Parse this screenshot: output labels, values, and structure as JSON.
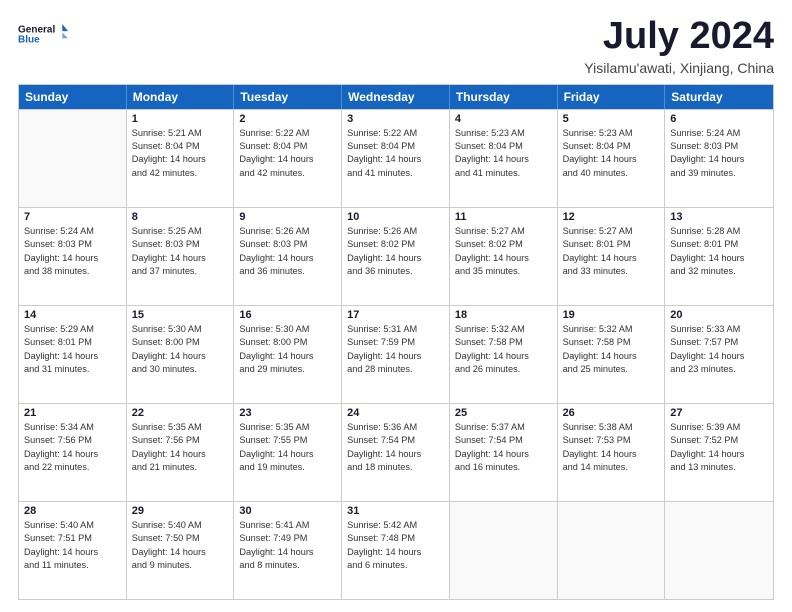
{
  "logo": {
    "line1": "General",
    "line2": "Blue"
  },
  "title": "July 2024",
  "subtitle": "Yisilamu'awati, Xinjiang, China",
  "header_days": [
    "Sunday",
    "Monday",
    "Tuesday",
    "Wednesday",
    "Thursday",
    "Friday",
    "Saturday"
  ],
  "weeks": [
    [
      {
        "day": "",
        "lines": []
      },
      {
        "day": "1",
        "lines": [
          "Sunrise: 5:21 AM",
          "Sunset: 8:04 PM",
          "Daylight: 14 hours",
          "and 42 minutes."
        ]
      },
      {
        "day": "2",
        "lines": [
          "Sunrise: 5:22 AM",
          "Sunset: 8:04 PM",
          "Daylight: 14 hours",
          "and 42 minutes."
        ]
      },
      {
        "day": "3",
        "lines": [
          "Sunrise: 5:22 AM",
          "Sunset: 8:04 PM",
          "Daylight: 14 hours",
          "and 41 minutes."
        ]
      },
      {
        "day": "4",
        "lines": [
          "Sunrise: 5:23 AM",
          "Sunset: 8:04 PM",
          "Daylight: 14 hours",
          "and 41 minutes."
        ]
      },
      {
        "day": "5",
        "lines": [
          "Sunrise: 5:23 AM",
          "Sunset: 8:04 PM",
          "Daylight: 14 hours",
          "and 40 minutes."
        ]
      },
      {
        "day": "6",
        "lines": [
          "Sunrise: 5:24 AM",
          "Sunset: 8:03 PM",
          "Daylight: 14 hours",
          "and 39 minutes."
        ]
      }
    ],
    [
      {
        "day": "7",
        "lines": [
          "Sunrise: 5:24 AM",
          "Sunset: 8:03 PM",
          "Daylight: 14 hours",
          "and 38 minutes."
        ]
      },
      {
        "day": "8",
        "lines": [
          "Sunrise: 5:25 AM",
          "Sunset: 8:03 PM",
          "Daylight: 14 hours",
          "and 37 minutes."
        ]
      },
      {
        "day": "9",
        "lines": [
          "Sunrise: 5:26 AM",
          "Sunset: 8:03 PM",
          "Daylight: 14 hours",
          "and 36 minutes."
        ]
      },
      {
        "day": "10",
        "lines": [
          "Sunrise: 5:26 AM",
          "Sunset: 8:02 PM",
          "Daylight: 14 hours",
          "and 36 minutes."
        ]
      },
      {
        "day": "11",
        "lines": [
          "Sunrise: 5:27 AM",
          "Sunset: 8:02 PM",
          "Daylight: 14 hours",
          "and 35 minutes."
        ]
      },
      {
        "day": "12",
        "lines": [
          "Sunrise: 5:27 AM",
          "Sunset: 8:01 PM",
          "Daylight: 14 hours",
          "and 33 minutes."
        ]
      },
      {
        "day": "13",
        "lines": [
          "Sunrise: 5:28 AM",
          "Sunset: 8:01 PM",
          "Daylight: 14 hours",
          "and 32 minutes."
        ]
      }
    ],
    [
      {
        "day": "14",
        "lines": [
          "Sunrise: 5:29 AM",
          "Sunset: 8:01 PM",
          "Daylight: 14 hours",
          "and 31 minutes."
        ]
      },
      {
        "day": "15",
        "lines": [
          "Sunrise: 5:30 AM",
          "Sunset: 8:00 PM",
          "Daylight: 14 hours",
          "and 30 minutes."
        ]
      },
      {
        "day": "16",
        "lines": [
          "Sunrise: 5:30 AM",
          "Sunset: 8:00 PM",
          "Daylight: 14 hours",
          "and 29 minutes."
        ]
      },
      {
        "day": "17",
        "lines": [
          "Sunrise: 5:31 AM",
          "Sunset: 7:59 PM",
          "Daylight: 14 hours",
          "and 28 minutes."
        ]
      },
      {
        "day": "18",
        "lines": [
          "Sunrise: 5:32 AM",
          "Sunset: 7:58 PM",
          "Daylight: 14 hours",
          "and 26 minutes."
        ]
      },
      {
        "day": "19",
        "lines": [
          "Sunrise: 5:32 AM",
          "Sunset: 7:58 PM",
          "Daylight: 14 hours",
          "and 25 minutes."
        ]
      },
      {
        "day": "20",
        "lines": [
          "Sunrise: 5:33 AM",
          "Sunset: 7:57 PM",
          "Daylight: 14 hours",
          "and 23 minutes."
        ]
      }
    ],
    [
      {
        "day": "21",
        "lines": [
          "Sunrise: 5:34 AM",
          "Sunset: 7:56 PM",
          "Daylight: 14 hours",
          "and 22 minutes."
        ]
      },
      {
        "day": "22",
        "lines": [
          "Sunrise: 5:35 AM",
          "Sunset: 7:56 PM",
          "Daylight: 14 hours",
          "and 21 minutes."
        ]
      },
      {
        "day": "23",
        "lines": [
          "Sunrise: 5:35 AM",
          "Sunset: 7:55 PM",
          "Daylight: 14 hours",
          "and 19 minutes."
        ]
      },
      {
        "day": "24",
        "lines": [
          "Sunrise: 5:36 AM",
          "Sunset: 7:54 PM",
          "Daylight: 14 hours",
          "and 18 minutes."
        ]
      },
      {
        "day": "25",
        "lines": [
          "Sunrise: 5:37 AM",
          "Sunset: 7:54 PM",
          "Daylight: 14 hours",
          "and 16 minutes."
        ]
      },
      {
        "day": "26",
        "lines": [
          "Sunrise: 5:38 AM",
          "Sunset: 7:53 PM",
          "Daylight: 14 hours",
          "and 14 minutes."
        ]
      },
      {
        "day": "27",
        "lines": [
          "Sunrise: 5:39 AM",
          "Sunset: 7:52 PM",
          "Daylight: 14 hours",
          "and 13 minutes."
        ]
      }
    ],
    [
      {
        "day": "28",
        "lines": [
          "Sunrise: 5:40 AM",
          "Sunset: 7:51 PM",
          "Daylight: 14 hours",
          "and 11 minutes."
        ]
      },
      {
        "day": "29",
        "lines": [
          "Sunrise: 5:40 AM",
          "Sunset: 7:50 PM",
          "Daylight: 14 hours",
          "and 9 minutes."
        ]
      },
      {
        "day": "30",
        "lines": [
          "Sunrise: 5:41 AM",
          "Sunset: 7:49 PM",
          "Daylight: 14 hours",
          "and 8 minutes."
        ]
      },
      {
        "day": "31",
        "lines": [
          "Sunrise: 5:42 AM",
          "Sunset: 7:48 PM",
          "Daylight: 14 hours",
          "and 6 minutes."
        ]
      },
      {
        "day": "",
        "lines": []
      },
      {
        "day": "",
        "lines": []
      },
      {
        "day": "",
        "lines": []
      }
    ]
  ]
}
